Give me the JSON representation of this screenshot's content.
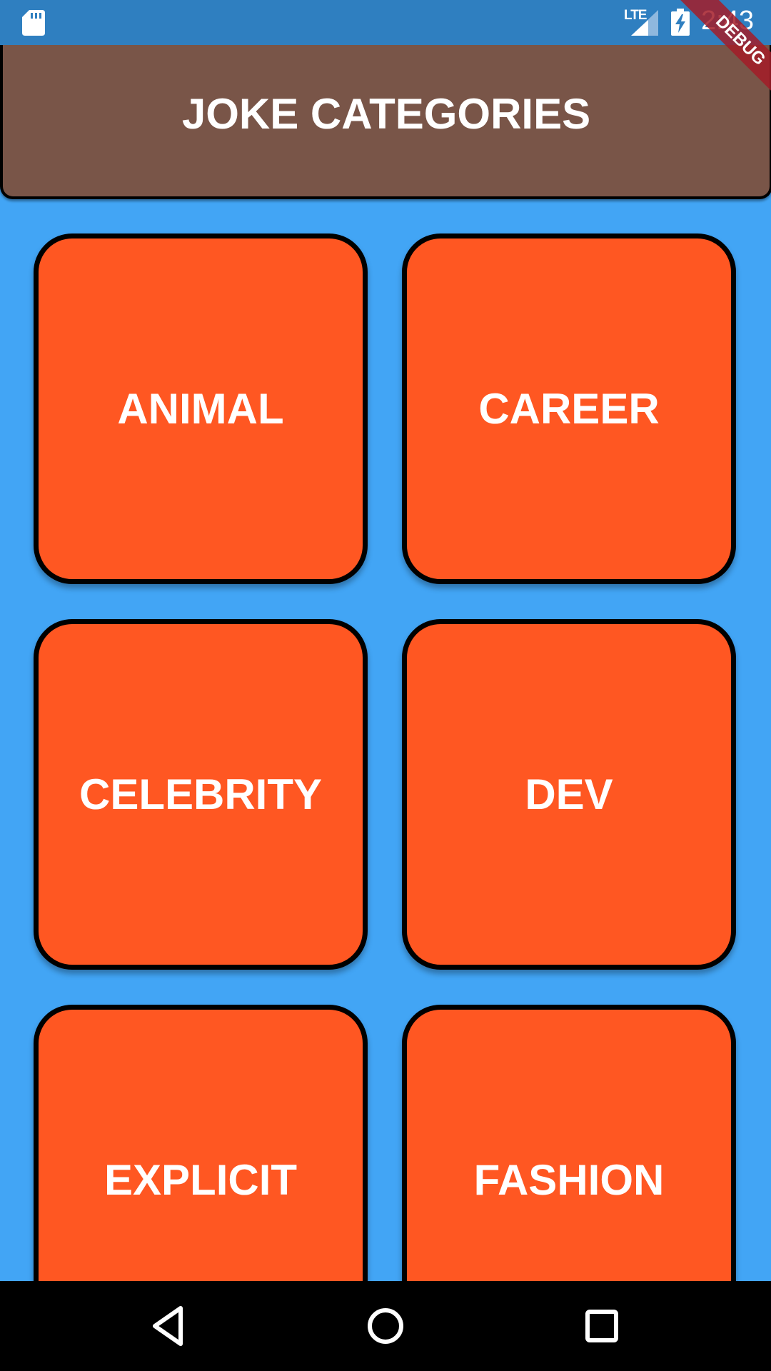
{
  "status_bar": {
    "network": "LTE",
    "time": "2:43",
    "icons": [
      "sd-card-icon",
      "signal-icon",
      "battery-charging-icon"
    ]
  },
  "debug_banner": "DEBUG",
  "header": {
    "title": "JOKE CATEGORIES"
  },
  "categories": [
    {
      "label": "ANIMAL"
    },
    {
      "label": "CAREER"
    },
    {
      "label": "CELEBRITY"
    },
    {
      "label": "DEV"
    },
    {
      "label": "EXPLICIT"
    },
    {
      "label": "FASHION"
    }
  ],
  "nav_bar": {
    "icons": [
      "back-icon",
      "home-icon",
      "recents-icon"
    ]
  },
  "colors": {
    "background": "#42A5F5",
    "status_bar": "#2F7FC0",
    "header": "#795548",
    "tile": "#FF5722",
    "tile_border": "#000000",
    "text": "#FFFFFF"
  }
}
